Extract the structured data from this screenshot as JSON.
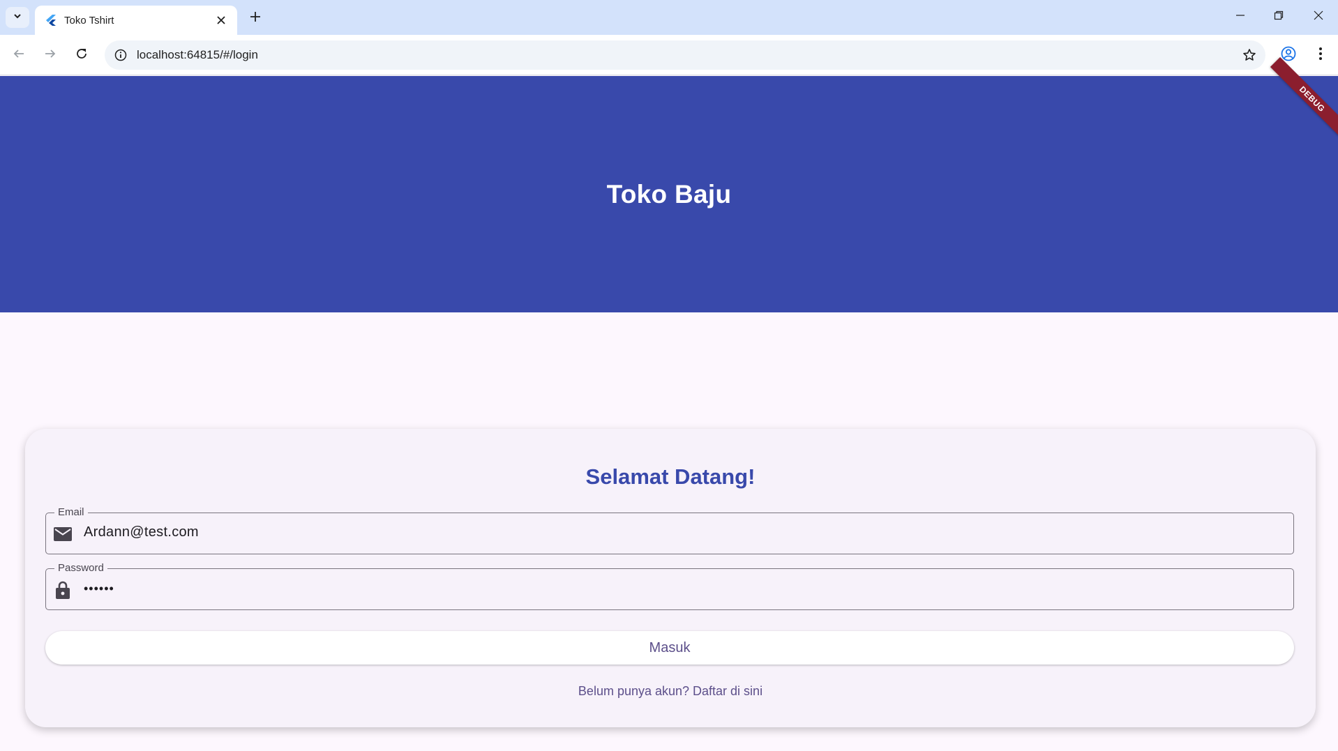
{
  "browser": {
    "tab_title": "Toko Tshirt",
    "url": "localhost:64815/#/login"
  },
  "app": {
    "header_title": "Toko Baju",
    "header_color": "#3949ab",
    "debug_banner": "DEBUG"
  },
  "login": {
    "welcome": "Selamat Datang!",
    "email_label": "Email",
    "email_value": "Ardann@test.com",
    "password_label": "Password",
    "password_value": "••••••",
    "submit_label": "Masuk",
    "register_link": "Belum punya akun? Daftar di sini"
  },
  "icons": {
    "email": "mail-icon",
    "password": "lock-icon"
  }
}
